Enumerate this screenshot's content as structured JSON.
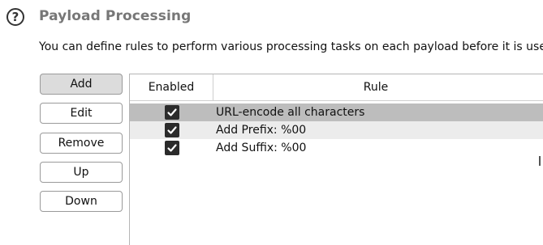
{
  "header": {
    "help_icon_glyph": "?",
    "title": "Payload Processing",
    "description": "You can define rules to perform various processing tasks on each payload before it is used."
  },
  "buttons": {
    "add": "Add",
    "edit": "Edit",
    "remove": "Remove",
    "up": "Up",
    "down": "Down"
  },
  "table": {
    "columns": [
      "Enabled",
      "Rule"
    ],
    "rows": [
      {
        "enabled": true,
        "rule": "URL-encode all characters",
        "selected": true
      },
      {
        "enabled": true,
        "rule": "Add Prefix: %00",
        "selected": false
      },
      {
        "enabled": true,
        "rule": "Add Suffix: %00",
        "selected": false
      }
    ]
  },
  "colors": {
    "selected_row": "#bdbdbd",
    "alt_row": "#ececec",
    "title_text": "#777777",
    "checkbox": "#2b2b2b"
  }
}
